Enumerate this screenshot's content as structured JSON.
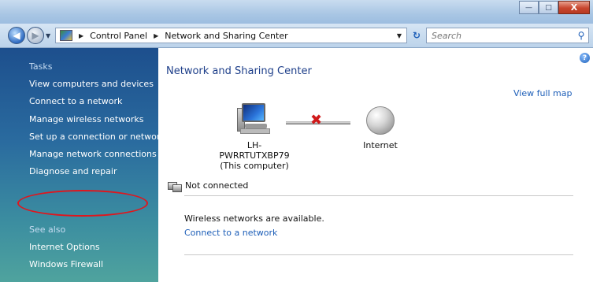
{
  "window": {
    "minimize_icon": "minimize-icon",
    "maximize_icon": "maximize-icon",
    "close_label": "X"
  },
  "address_bar": {
    "breadcrumb": [
      "Control Panel",
      "Network and Sharing Center"
    ],
    "search_placeholder": "Search"
  },
  "sidebar": {
    "tasks_title": "Tasks",
    "tasks": [
      "View computers and devices",
      "Connect to a network",
      "Manage wireless networks",
      "Set up a connection or network",
      "Manage network connections",
      "Diagnose and repair"
    ],
    "see_also_title": "See also",
    "see_also": [
      "Internet Options",
      "Windows Firewall"
    ],
    "highlight_color": "#e0161d"
  },
  "main": {
    "title": "Network and Sharing Center",
    "view_full_map": "View full map",
    "computer_name": "LH-PWRRTUTXBP79",
    "computer_sub": "(This computer)",
    "internet_label": "Internet",
    "status": "Not connected",
    "wireless_msg": "Wireless networks are available.",
    "connect_link": "Connect to a network"
  },
  "colors": {
    "title_color": "#1e3f8a",
    "link_color": "#1e5fb8",
    "disconnect_color": "#d0191a"
  }
}
